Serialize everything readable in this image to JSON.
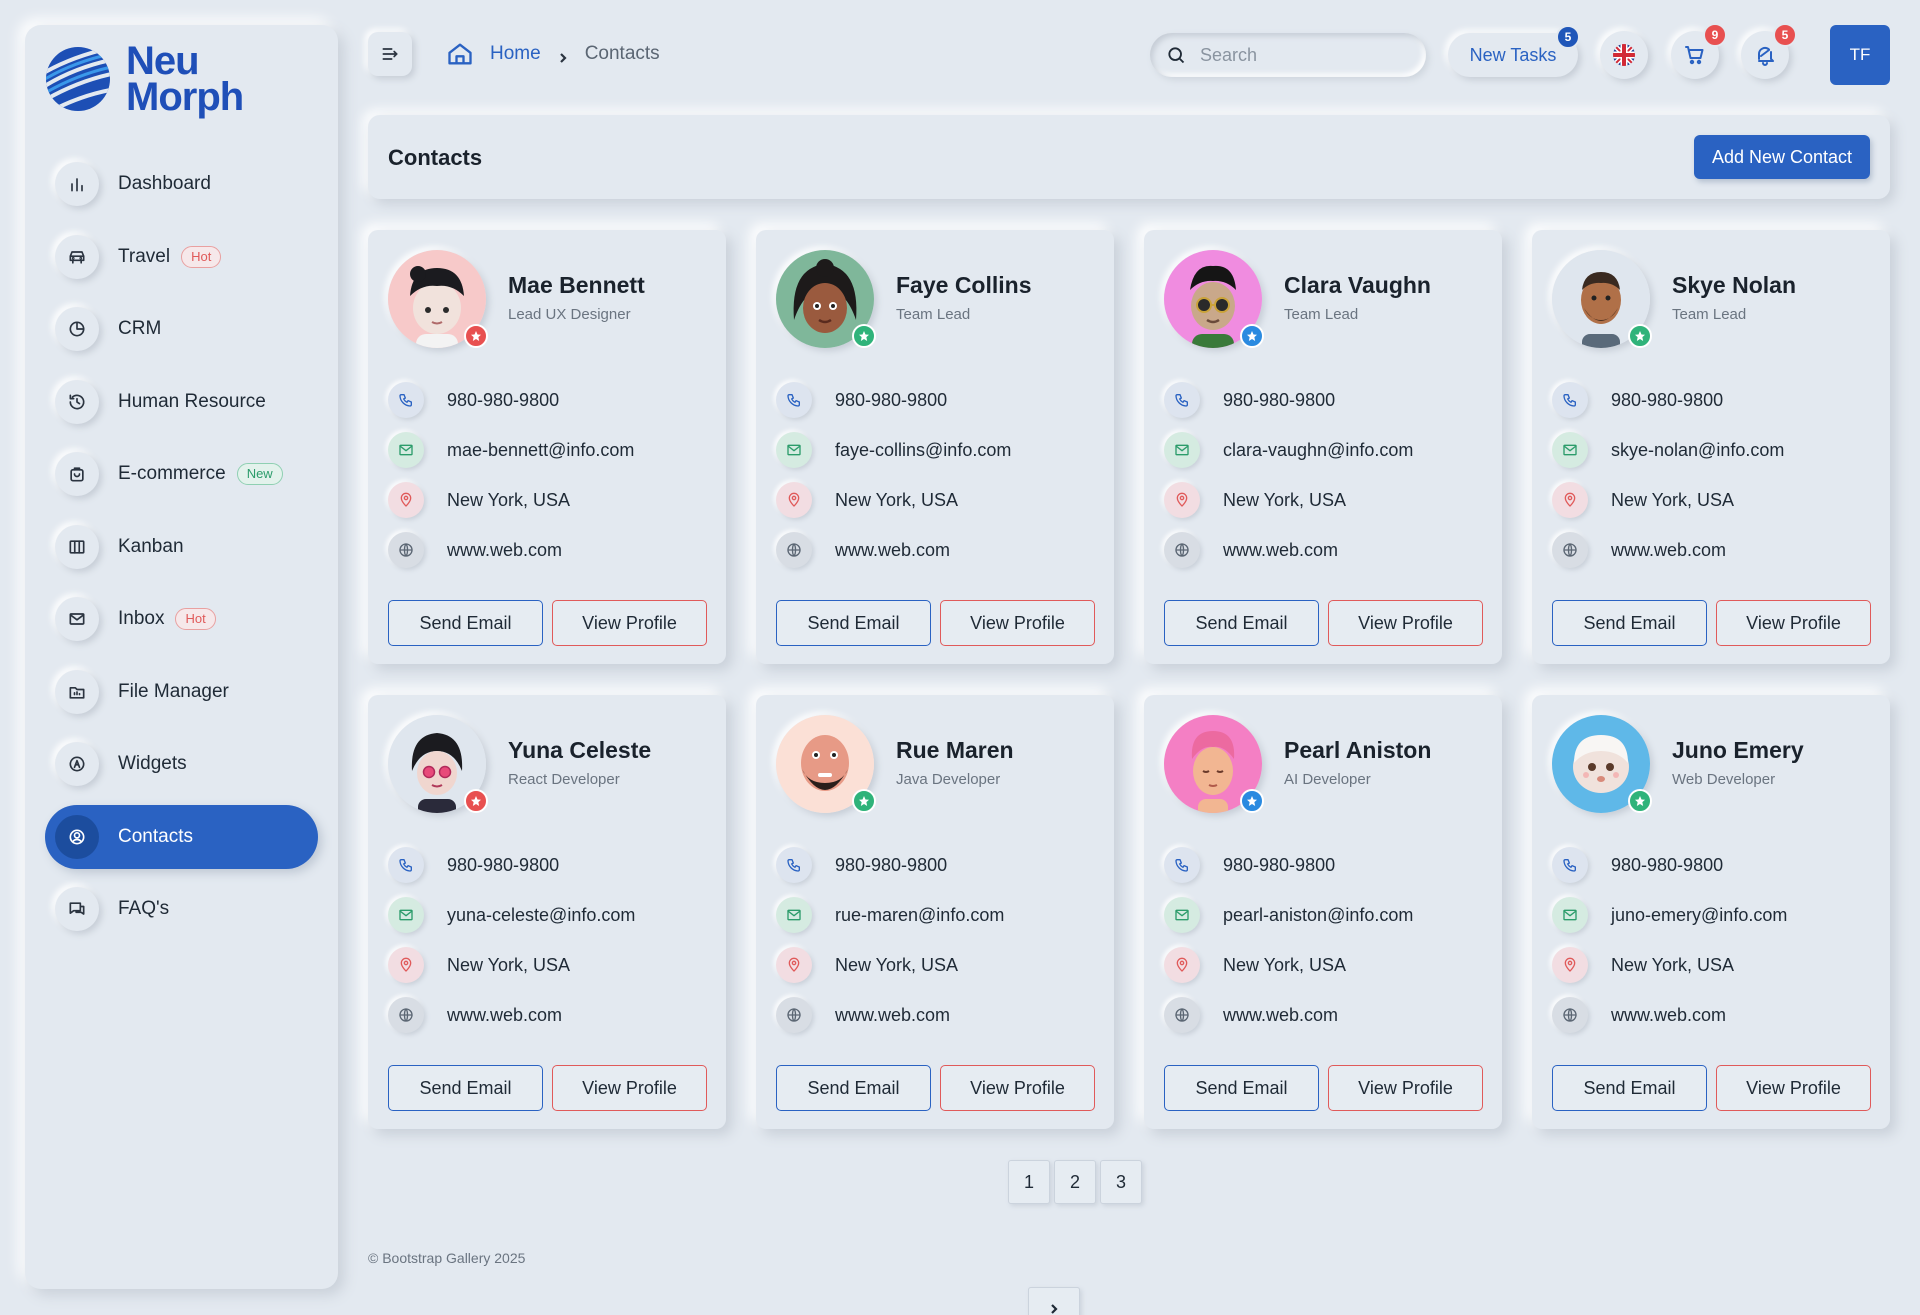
{
  "brand": {
    "line1": "Neu",
    "line2": "Morph"
  },
  "sidebar": {
    "items": [
      {
        "label": "Dashboard",
        "icon": "bar-chart-icon"
      },
      {
        "label": "Travel",
        "icon": "car-icon",
        "badge": "Hot"
      },
      {
        "label": "CRM",
        "icon": "pie-chart-icon"
      },
      {
        "label": "Human Resource",
        "icon": "history-icon"
      },
      {
        "label": "E-commerce",
        "icon": "shopping-bag-icon",
        "badge": "New"
      },
      {
        "label": "Kanban",
        "icon": "columns-icon"
      },
      {
        "label": "Inbox",
        "icon": "mail-icon",
        "badge": "Hot"
      },
      {
        "label": "File Manager",
        "icon": "folder-icon"
      },
      {
        "label": "Widgets",
        "icon": "widget-icon"
      },
      {
        "label": "Contacts",
        "icon": "user-circle-icon",
        "active": true
      },
      {
        "label": "FAQ's",
        "icon": "chat-icon"
      }
    ]
  },
  "header": {
    "breadcrumb": {
      "home": "Home",
      "current": "Contacts"
    },
    "search_placeholder": "Search",
    "tasks_label": "New Tasks",
    "tasks_count": "5",
    "cart_count": "9",
    "notif_count": "5",
    "user_initials": "TF"
  },
  "page": {
    "title": "Contacts",
    "add_button": "Add New Contact"
  },
  "contacts": [
    {
      "name": "Mae Bennett",
      "role": "Lead UX Designer",
      "phone": "980-980-9800",
      "email": "mae-bennett@info.com",
      "location": "New York, USA",
      "website": "www.web.com",
      "star_color": "#e85050"
    },
    {
      "name": "Faye Collins",
      "role": "Team Lead",
      "phone": "980-980-9800",
      "email": "faye-collins@info.com",
      "location": "New York, USA",
      "website": "www.web.com",
      "star_color": "#2fb37a"
    },
    {
      "name": "Clara Vaughn",
      "role": "Team Lead",
      "phone": "980-980-9800",
      "email": "clara-vaughn@info.com",
      "location": "New York, USA",
      "website": "www.web.com",
      "star_color": "#2a8ae0"
    },
    {
      "name": "Skye Nolan",
      "role": "Team Lead",
      "phone": "980-980-9800",
      "email": "skye-nolan@info.com",
      "location": "New York, USA",
      "website": "www.web.com",
      "star_color": "#2fb37a"
    },
    {
      "name": "Yuna Celeste",
      "role": "React Developer",
      "phone": "980-980-9800",
      "email": "yuna-celeste@info.com",
      "location": "New York, USA",
      "website": "www.web.com",
      "star_color": "#e85050"
    },
    {
      "name": "Rue Maren",
      "role": "Java Developer",
      "phone": "980-980-9800",
      "email": "rue-maren@info.com",
      "location": "New York, USA",
      "website": "www.web.com",
      "star_color": "#2fb37a"
    },
    {
      "name": "Pearl Aniston",
      "role": "AI Developer",
      "phone": "980-980-9800",
      "email": "pearl-aniston@info.com",
      "location": "New York, USA",
      "website": "www.web.com",
      "star_color": "#2a8ae0"
    },
    {
      "name": "Juno Emery",
      "role": "Web Developer",
      "phone": "980-980-9800",
      "email": "juno-emery@info.com",
      "location": "New York, USA",
      "website": "www.web.com",
      "star_color": "#2fb37a"
    }
  ],
  "card_buttons": {
    "email": "Send Email",
    "profile": "View Profile"
  },
  "pagination": {
    "pages": [
      "1",
      "2",
      "3"
    ]
  },
  "footer": "© Bootstrap Gallery 2025",
  "colors": {
    "accent": "#2a62c2",
    "background": "#e3e9f0",
    "danger": "#e05a5a",
    "success": "#2c9c6b"
  }
}
